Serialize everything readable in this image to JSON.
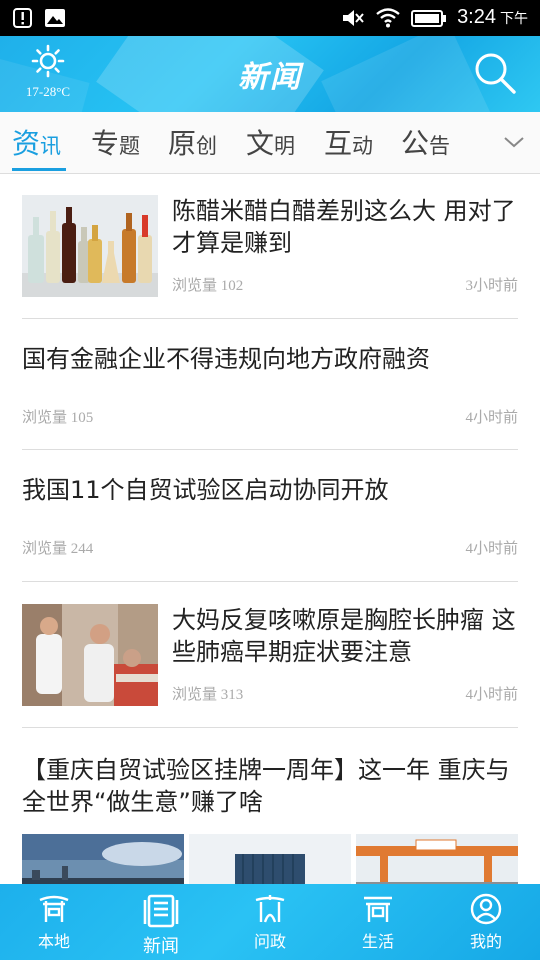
{
  "status_bar": {
    "time": "3:24",
    "period": "下午",
    "icons": [
      "alert-icon",
      "image-icon",
      "mute-icon",
      "wifi-icon",
      "battery-icon"
    ]
  },
  "header": {
    "title": "新闻",
    "weather": {
      "icon": "sun-icon",
      "temperature": "17-28°C"
    },
    "search_icon": "search-icon",
    "background_color": "#1fb0ea"
  },
  "tabs": [
    {
      "label_big": "资",
      "label_small": "讯",
      "active": true
    },
    {
      "label_big": "专",
      "label_small": "题",
      "active": false
    },
    {
      "label_big": "原",
      "label_small": "创",
      "active": false
    },
    {
      "label_big": "文",
      "label_small": "明",
      "active": false
    },
    {
      "label_big": "互",
      "label_small": "动",
      "active": false
    },
    {
      "label_big": "公",
      "label_small": "告",
      "active": false
    }
  ],
  "accent_color": "#1a9fe0",
  "feed": [
    {
      "title": "陈醋米醋白醋差别这么大 用对了才算是赚到",
      "views": "浏览量 102",
      "time": "3小时前",
      "thumbnail": "vinegar-bottles"
    },
    {
      "title": "国有金融企业不得违规向地方政府融资",
      "views": "浏览量 105",
      "time": "4小时前"
    },
    {
      "title": "我国11个自贸试验区启动协同开放",
      "views": "浏览量 244",
      "time": "4小时前"
    },
    {
      "title": "大妈反复咳嗽原是胸腔长肿瘤 这些肺癌早期症状要注意",
      "views": "浏览量 313",
      "time": "4小时前",
      "thumbnail": "doctor-patient"
    },
    {
      "title": "【重庆自贸试验区挂牌一周年】这一年 重庆与全世界“做生意”赚了啥",
      "thumbnails": [
        "city-skyline",
        "shipping-container",
        "port-crane"
      ]
    }
  ],
  "bottom_nav": [
    {
      "label": "本地",
      "icon": "local-gate-icon",
      "active": false
    },
    {
      "label": "新闻",
      "icon": "newspaper-icon",
      "active": true
    },
    {
      "label": "问政",
      "icon": "government-hall-icon",
      "active": false
    },
    {
      "label": "生活",
      "icon": "shop-icon",
      "active": false
    },
    {
      "label": "我的",
      "icon": "profile-icon",
      "active": false
    }
  ]
}
